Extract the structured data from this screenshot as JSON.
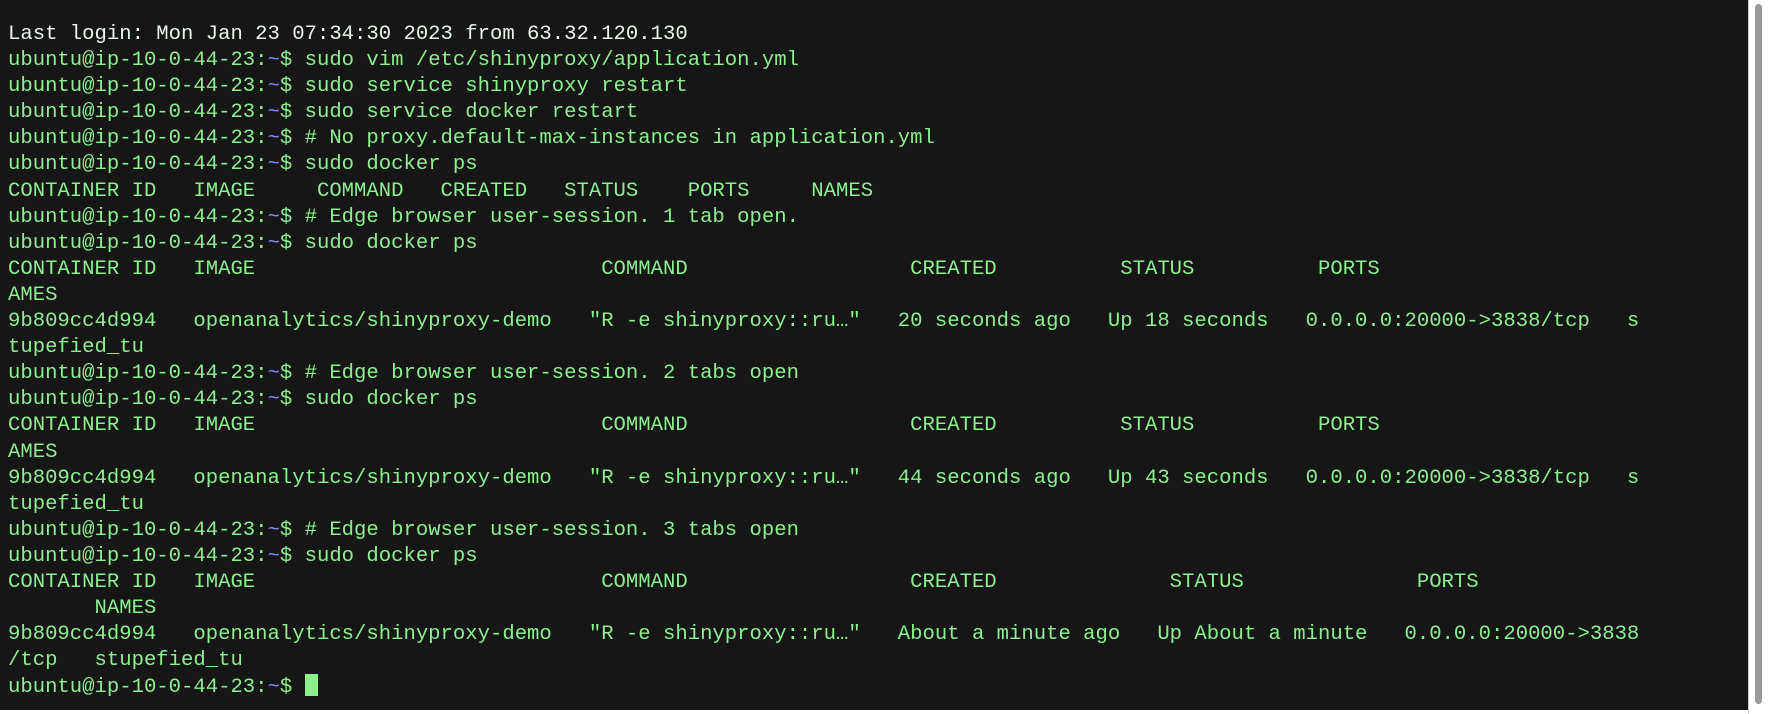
{
  "terminal": {
    "login": "Last login: Mon Jan 23 07:34:30 2023 from 63.32.120.130",
    "prompt": {
      "user_host": "ubuntu@ip-10-0-44-23:",
      "path": "~",
      "symbol": "$ "
    },
    "lines": [
      {
        "type": "prompt",
        "cmd": "sudo vim /etc/shinyproxy/application.yml"
      },
      {
        "type": "prompt",
        "cmd": "sudo service shinyproxy restart"
      },
      {
        "type": "prompt",
        "cmd": "sudo service docker restart"
      },
      {
        "type": "prompt",
        "cmd": "# No proxy.default-max-instances in application.yml"
      },
      {
        "type": "prompt",
        "cmd": "sudo docker ps"
      },
      {
        "type": "output",
        "text": "CONTAINER ID   IMAGE     COMMAND   CREATED   STATUS    PORTS     NAMES"
      },
      {
        "type": "prompt",
        "cmd": "# Edge browser user-session. 1 tab open."
      },
      {
        "type": "prompt",
        "cmd": "sudo docker ps"
      },
      {
        "type": "output",
        "text": "CONTAINER ID   IMAGE                            COMMAND                  CREATED          STATUS          PORTS                                       N"
      },
      {
        "type": "output",
        "text": "AMES"
      },
      {
        "type": "output",
        "text": "9b809cc4d994   openanalytics/shinyproxy-demo   \"R -e shinyproxy::ru…\"   20 seconds ago   Up 18 seconds   0.0.0.0:20000->3838/tcp   s"
      },
      {
        "type": "output",
        "text": "tupefied_tu"
      },
      {
        "type": "prompt",
        "cmd": "# Edge browser user-session. 2 tabs open"
      },
      {
        "type": "prompt",
        "cmd": "sudo docker ps"
      },
      {
        "type": "output",
        "text": "CONTAINER ID   IMAGE                            COMMAND                  CREATED          STATUS          PORTS                                       N"
      },
      {
        "type": "output",
        "text": "AMES"
      },
      {
        "type": "output",
        "text": "9b809cc4d994   openanalytics/shinyproxy-demo   \"R -e shinyproxy::ru…\"   44 seconds ago   Up 43 seconds   0.0.0.0:20000->3838/tcp   s"
      },
      {
        "type": "output",
        "text": "tupefied_tu"
      },
      {
        "type": "prompt",
        "cmd": "# Edge browser user-session. 3 tabs open"
      },
      {
        "type": "prompt",
        "cmd": "sudo docker ps"
      },
      {
        "type": "output",
        "text": "CONTAINER ID   IMAGE                            COMMAND                  CREATED              STATUS              PORTS                     "
      },
      {
        "type": "output",
        "text": "       NAMES"
      },
      {
        "type": "output",
        "text": "9b809cc4d994   openanalytics/shinyproxy-demo   \"R -e shinyproxy::ru…\"   About a minute ago   Up About a minute   0.0.0.0:20000->3838"
      },
      {
        "type": "output",
        "text": "/tcp   stupefied_tu"
      },
      {
        "type": "active_prompt",
        "cmd": ""
      }
    ]
  },
  "colors": {
    "background": "#161616",
    "text": "#8cf08e",
    "login_text": "#e8f5e8",
    "path": "#7c8cff"
  }
}
